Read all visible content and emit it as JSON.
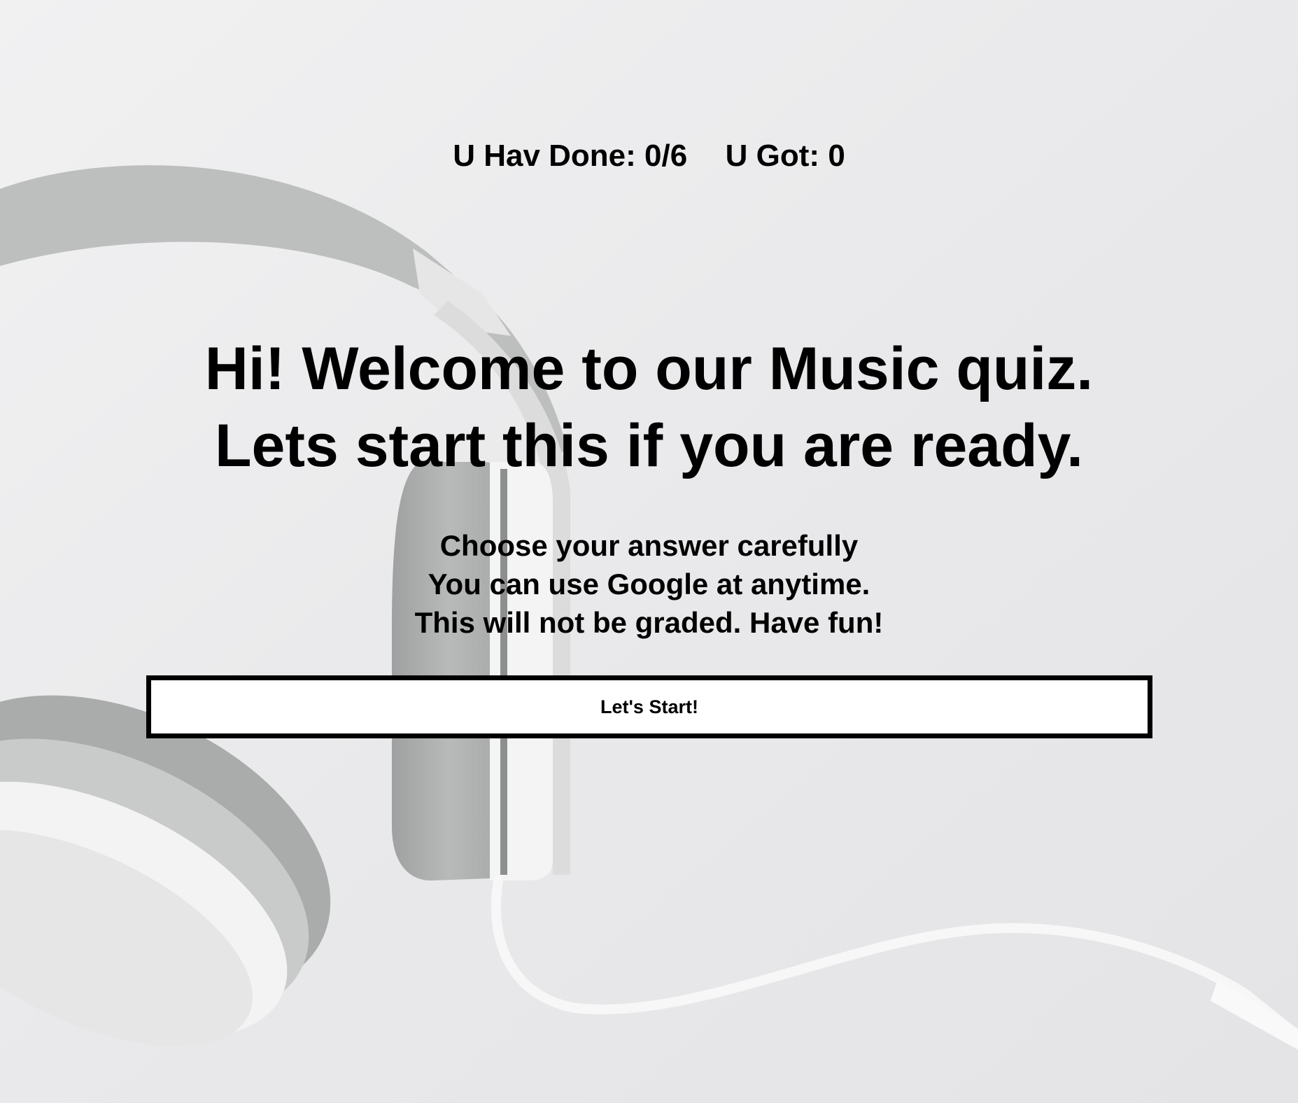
{
  "status": {
    "done_label": "U Hav Done:",
    "done_value": "0/6",
    "got_label": "U Got:",
    "got_value": "0"
  },
  "welcome": {
    "line1": "Hi! Welcome to our Music quiz.",
    "line2": "Lets start this if you are ready."
  },
  "instructions": [
    "Choose your answer carefully",
    "You can use Google at anytime.",
    "This will not be graded. Have fun!"
  ],
  "start_button_label": "Let's Start!",
  "colors": {
    "background": "#ececed",
    "text": "#000000",
    "button_bg": "#ffffff",
    "button_border": "#000000"
  },
  "background_image": "headphones-photo"
}
